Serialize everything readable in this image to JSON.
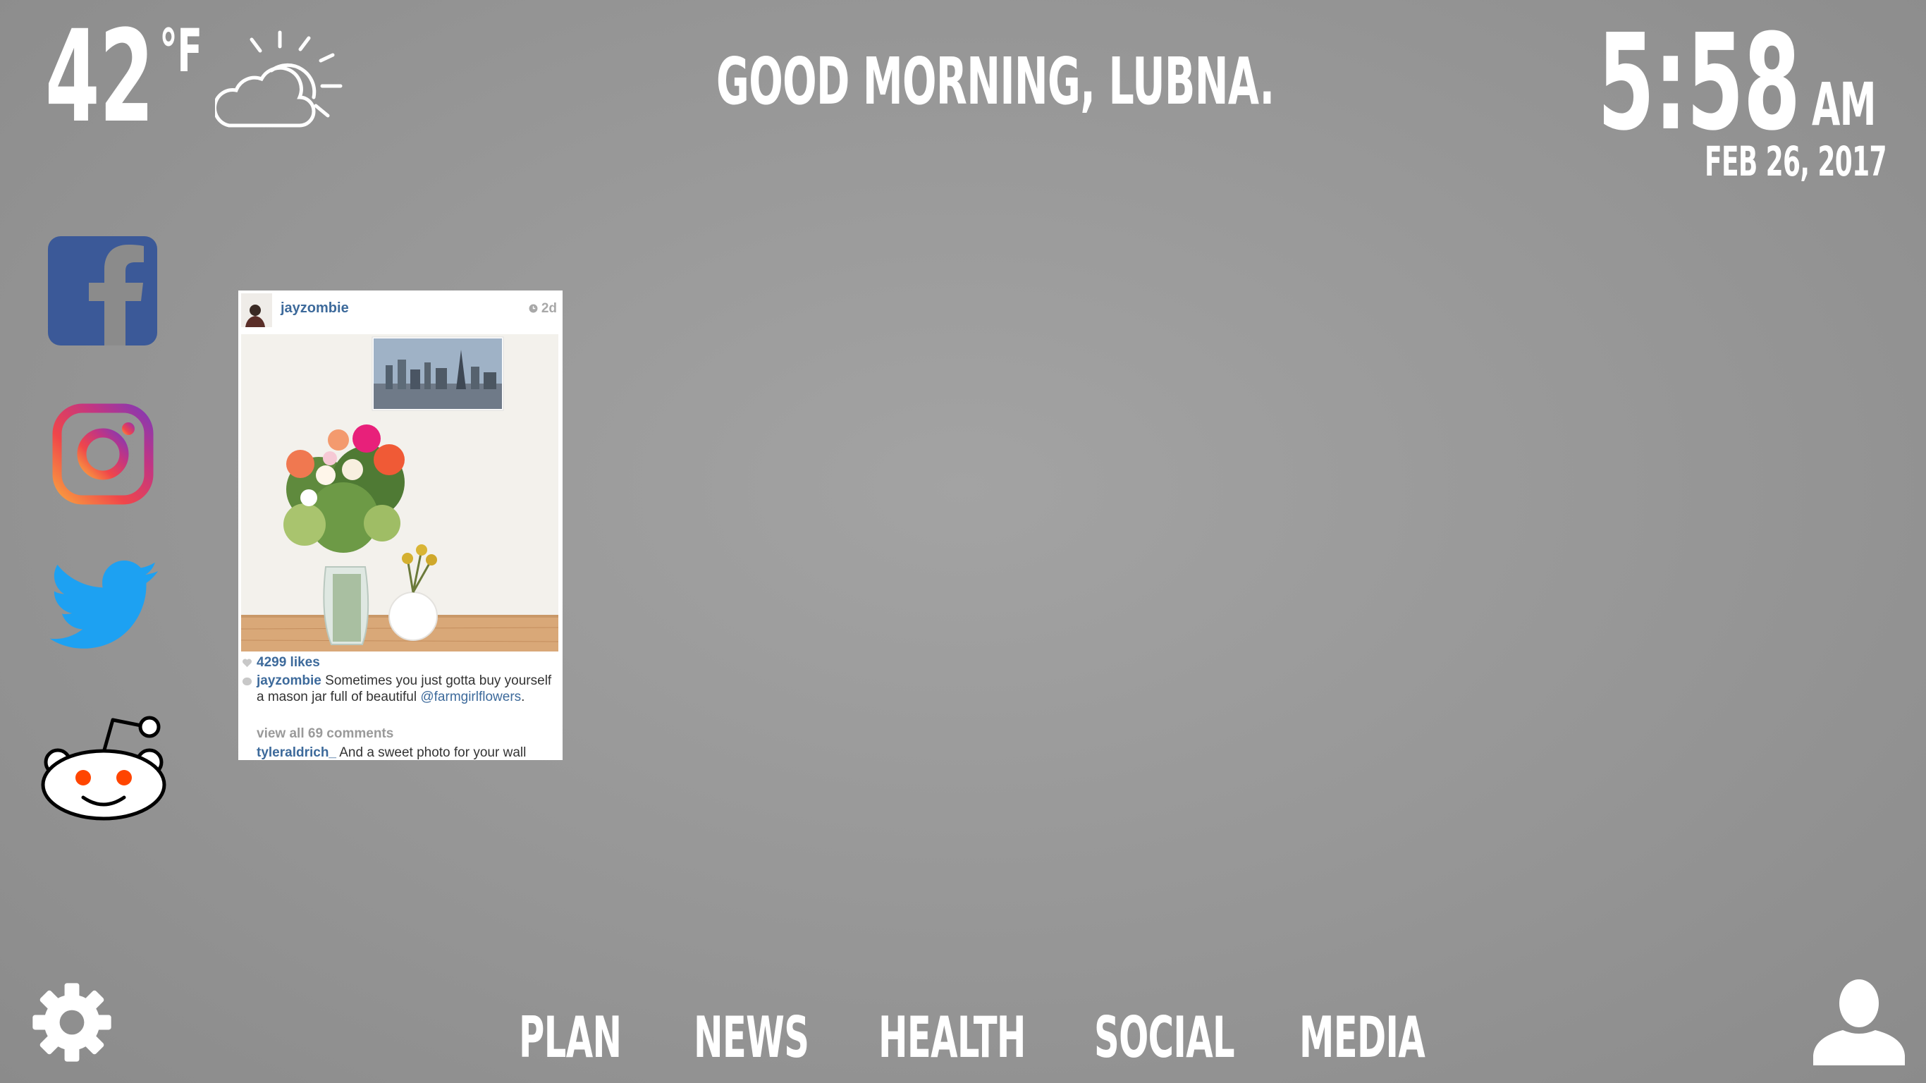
{
  "weather": {
    "temperature": "42",
    "unit": "°F",
    "condition_icon": "partly-cloudy-icon"
  },
  "greeting": "GOOD MORNING, LUBNA.",
  "clock": {
    "time": "5:58",
    "ampm": "AM",
    "date": "FEB 26, 2017"
  },
  "social_sidebar": [
    {
      "name": "facebook",
      "icon": "facebook-icon",
      "color": "#3b5998"
    },
    {
      "name": "instagram",
      "icon": "instagram-icon",
      "color": "#c13584"
    },
    {
      "name": "twitter",
      "icon": "twitter-icon",
      "color": "#1da1f2"
    },
    {
      "name": "reddit",
      "icon": "reddit-icon",
      "color": "#ff4500"
    }
  ],
  "instagram_post": {
    "username": "jayzombie",
    "age": "2d",
    "likes": "4299 likes",
    "caption_user": "jayzombie",
    "caption_text": "Sometimes you just gotta buy yourself a mason jar full of beautiful",
    "caption_mention": "@farmgirlflowers",
    "caption_end": ".",
    "view_comments": "view all 69 comments",
    "comment_user": "tyleraldrich_",
    "comment_text": "And a sweet photo for your wall"
  },
  "nav": {
    "plan": "PLAN",
    "news": "NEWS",
    "health": "HEALTH",
    "social": "SOCIAL",
    "media": "MEDIA"
  },
  "colors": {
    "background": "#999999",
    "text": "#ffffff",
    "instagram_link": "#3d6a9b"
  }
}
